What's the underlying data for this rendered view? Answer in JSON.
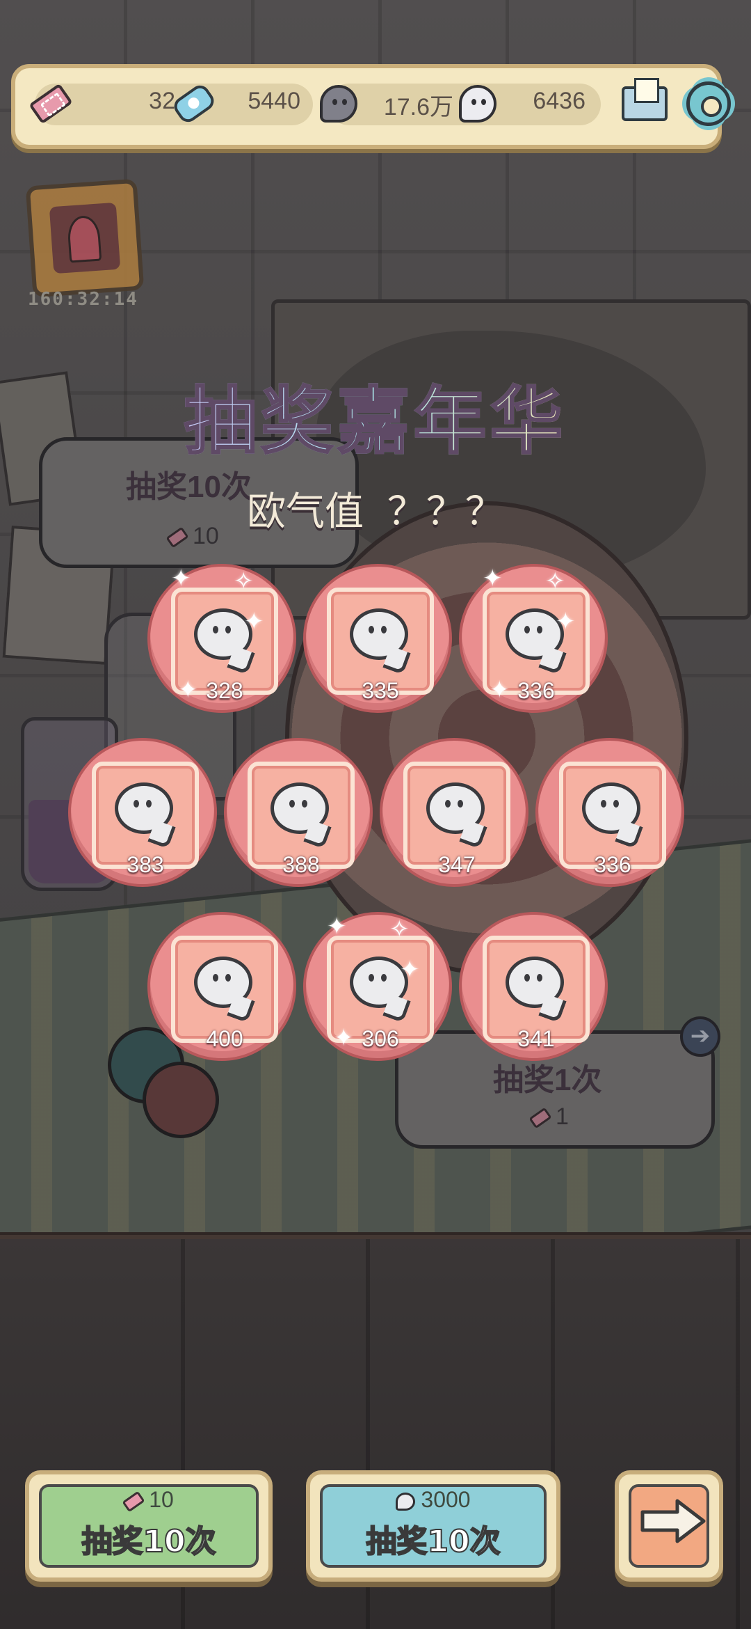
{
  "resources": {
    "tickets": "32",
    "candy": "5440",
    "dark_ghosts": "17.6万",
    "light_ghosts": "6436"
  },
  "event": {
    "timer": "160:32:14"
  },
  "popup": {
    "title": "抽奖嘉年华",
    "luck_label": "欧气值",
    "luck_value": "？？？"
  },
  "rewards": [
    {
      "amount": "328",
      "sparkle": true
    },
    {
      "amount": "335",
      "sparkle": false
    },
    {
      "amount": "336",
      "sparkle": true
    },
    {
      "amount": "383",
      "sparkle": false
    },
    {
      "amount": "388",
      "sparkle": false
    },
    {
      "amount": "347",
      "sparkle": false
    },
    {
      "amount": "336",
      "sparkle": false
    },
    {
      "amount": "400",
      "sparkle": false
    },
    {
      "amount": "306",
      "sparkle": true
    },
    {
      "amount": "341",
      "sparkle": false
    }
  ],
  "background_buttons": {
    "draw_ten_label": "抽奖10次",
    "draw_ten_cost": "10",
    "draw_one_label": "抽奖1次",
    "draw_one_cost": "1"
  },
  "buttons": {
    "ticket_draw": {
      "cost": "10",
      "label": "抽奖10次",
      "color": "#9fcf8f"
    },
    "ghost_draw": {
      "cost": "3000",
      "label": "抽奖10次",
      "color": "#8fcfd8"
    },
    "next": {
      "color": "#f2a882"
    }
  },
  "icons": {
    "ticket": "ticket-icon",
    "candy": "candy-icon",
    "dark_ghost": "ghost-dark-icon",
    "light_ghost": "ghost-light-icon",
    "mail": "mail-icon",
    "settings": "gear-icon",
    "next": "arrow-right-icon"
  }
}
